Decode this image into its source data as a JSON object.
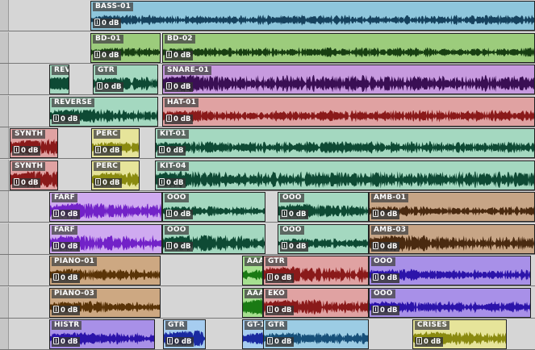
{
  "gain_label": "0 dB",
  "palette": {
    "blue": {
      "bg": "#8ec6dc",
      "wave": "#16425e"
    },
    "green": {
      "bg": "#9ccc7c",
      "wave": "#183f12"
    },
    "purple": {
      "bg": "#c79adf",
      "wave": "#3a0f54"
    },
    "salmon": {
      "bg": "#e0a2a2",
      "wave": "#8a1a1a"
    },
    "mint": {
      "bg": "#a4d8c0",
      "wave": "#0e4a34"
    },
    "tan": {
      "bg": "#c7a586",
      "wave": "#4a2a10"
    },
    "lilac": {
      "bg": "#cfaaf0",
      "wave": "#7222c8"
    },
    "olive": {
      "bg": "#cda882",
      "wave": "#5a3408"
    },
    "yellow": {
      "bg": "#e6e49a",
      "wave": "#8a8a10"
    },
    "sky": {
      "bg": "#a6cdf0",
      "wave": "#1a2aa0"
    },
    "cyan": {
      "bg": "#9ccce4",
      "wave": "#17507a"
    },
    "violet": {
      "bg": "#a890e8",
      "wave": "#2c14aa"
    },
    "lime": {
      "bg": "#a6e090",
      "wave": "#1a7a14"
    }
  },
  "tracks": [
    {
      "clips": [
        {
          "name": "BASS-01",
          "color": "blue"
        }
      ]
    },
    {
      "clips": [
        {
          "name": "BD-01",
          "color": "green"
        },
        {
          "name": "BD-02",
          "color": "green"
        }
      ]
    },
    {
      "clips": [
        {
          "name": "REV",
          "color": "mint"
        },
        {
          "name": "GTR",
          "color": "mint"
        },
        {
          "name": "SNARE-01",
          "color": "purple"
        }
      ]
    },
    {
      "clips": [
        {
          "name": "REVERSE",
          "color": "mint"
        },
        {
          "name": "HAT-01",
          "color": "salmon"
        }
      ]
    },
    {
      "clips": [
        {
          "name": "SYNTH",
          "color": "salmon"
        },
        {
          "name": "PERC",
          "color": "yellow"
        },
        {
          "name": "KIT-01",
          "color": "mint"
        }
      ]
    },
    {
      "clips": [
        {
          "name": "SYNTH",
          "color": "salmon"
        },
        {
          "name": "PERC",
          "color": "yellow"
        },
        {
          "name": "KIT-04",
          "color": "mint"
        }
      ]
    },
    {
      "clips": [
        {
          "name": "FARF",
          "color": "lilac"
        },
        {
          "name": "OOO",
          "color": "mint"
        },
        {
          "name": "OOO",
          "color": "mint"
        },
        {
          "name": "AMB-01",
          "color": "tan"
        }
      ]
    },
    {
      "clips": [
        {
          "name": "FARF",
          "color": "lilac"
        },
        {
          "name": "OOO",
          "color": "mint"
        },
        {
          "name": "OOO",
          "color": "mint"
        },
        {
          "name": "AMB-03",
          "color": "tan"
        }
      ]
    },
    {
      "clips": [
        {
          "name": "PIANO-01",
          "color": "olive"
        },
        {
          "name": "AAA",
          "color": "lime"
        },
        {
          "name": "GTR",
          "color": "salmon"
        },
        {
          "name": "OOO",
          "color": "violet"
        }
      ]
    },
    {
      "clips": [
        {
          "name": "PIANO-03",
          "color": "olive"
        },
        {
          "name": "AAA",
          "color": "lime"
        },
        {
          "name": "EKO",
          "color": "salmon"
        },
        {
          "name": "OOO",
          "color": "violet"
        }
      ]
    },
    {
      "clips": [
        {
          "name": "HISTR",
          "color": "violet"
        },
        {
          "name": "GTR",
          "color": "sky"
        },
        {
          "name": "GT-1",
          "color": "sky"
        },
        {
          "name": "GTR",
          "color": "cyan"
        },
        {
          "name": "CRISES",
          "color": "yellow"
        }
      ]
    }
  ]
}
